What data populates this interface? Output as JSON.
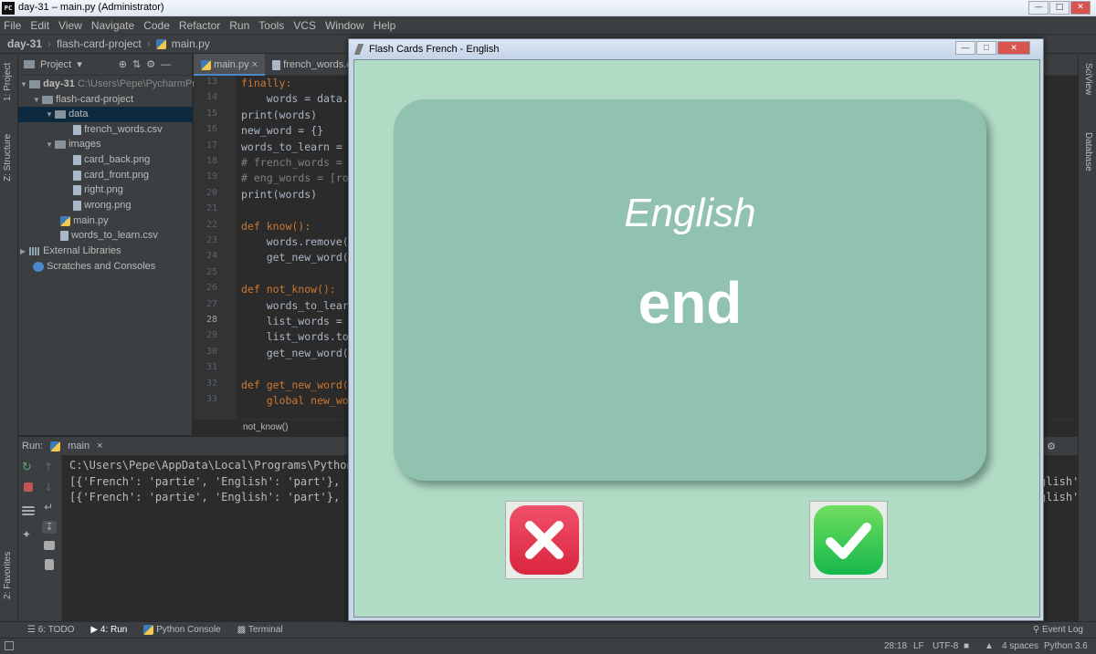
{
  "window": {
    "title": "day-31 – main.py (Administrator)",
    "logo": "PC"
  },
  "menu": [
    "File",
    "Edit",
    "View",
    "Navigate",
    "Code",
    "Refactor",
    "Run",
    "Tools",
    "VCS",
    "Window",
    "Help"
  ],
  "breadcrumb": [
    "day-31",
    "flash-card-project",
    "main.py"
  ],
  "project": {
    "header": "Project",
    "items": [
      {
        "label": "day-31",
        "path": "C:\\Users\\Pepe\\PycharmProj"
      },
      {
        "label": "flash-card-project"
      },
      {
        "label": "data"
      },
      {
        "label": "french_words.csv"
      },
      {
        "label": "images"
      },
      {
        "label": "card_back.png"
      },
      {
        "label": "card_front.png"
      },
      {
        "label": "right.png"
      },
      {
        "label": "wrong.png"
      },
      {
        "label": "main.py"
      },
      {
        "label": "words_to_learn.csv"
      },
      {
        "label": "External Libraries"
      },
      {
        "label": "Scratches and Consoles"
      }
    ]
  },
  "editor": {
    "tabs": [
      "main.py",
      "french_words.c"
    ],
    "line_numbers": [
      "13",
      "14",
      "15",
      "16",
      "17",
      "18",
      "19",
      "20",
      "21",
      "22",
      "23",
      "24",
      "25",
      "26",
      "27",
      "28",
      "29",
      "30",
      "31",
      "32",
      "33"
    ],
    "lines": [
      "finally:",
      "    words = data.t",
      "print(words)",
      "new_word = {}",
      "words_to_learn = [",
      "# french_words = ",
      "# eng_words = [ro",
      "print(words)",
      "",
      "def know():",
      "    words.remove(n",
      "    get_new_word()",
      "",
      "def not_know():",
      "    words_to_learn",
      "    list_words = p",
      "    list_words.to_",
      "    get_new_word()",
      "",
      "def get_new_word()",
      "    global new_wor"
    ],
    "context": "not_know()"
  },
  "left_strip": [
    "1: Project",
    "Z: Structure",
    "2: Favorites"
  ],
  "right_strip": [
    "SciView",
    "Database"
  ],
  "run": {
    "label": "Run:",
    "tab": "main",
    "output": [
      "C:\\Users\\Pepe\\AppData\\Local\\Programs\\Python\\Py",
      "[{'French': 'partie', 'English': 'part'}, {'Fr",
      "[{'French': 'partie', 'English': 'part'}, {'Fr"
    ],
    "output_right": [
      "glish'",
      "glish'"
    ]
  },
  "bottom_tools": [
    "6: TODO",
    "4: Run",
    "Python Console",
    "Terminal"
  ],
  "event_log": "Event Log",
  "status": {
    "position": "28:18",
    "line_sep": "LF",
    "encoding": "UTF-8",
    "indent": "4 spaces",
    "interpreter": "Python 3.6"
  },
  "tk_window": {
    "title": "Flash Cards French - English",
    "card_language": "English",
    "card_word": "end",
    "wrong_icon": "cross-icon",
    "right_icon": "check-icon"
  },
  "colors": {
    "ide_bg": "#2b2b2b",
    "panel_bg": "#3c3f41",
    "tk_bg": "#b1dbc5",
    "card_bg": "#91c2af",
    "wrong_red": "#e0364f",
    "right_green": "#2fc950"
  }
}
